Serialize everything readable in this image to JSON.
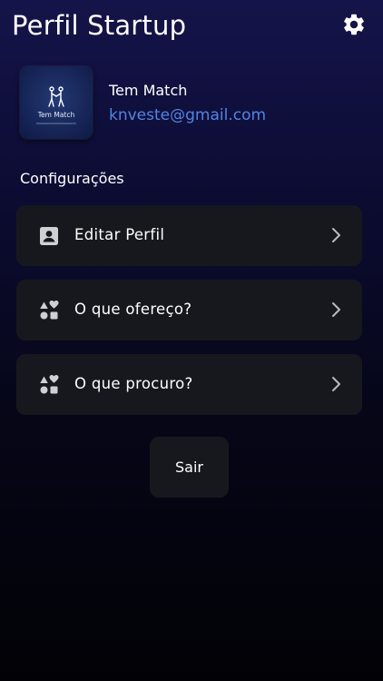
{
  "header": {
    "title": "Perfil Startup",
    "settings_icon": "gear-icon"
  },
  "profile": {
    "logo_text": "Tem Match",
    "name": "Tem Match",
    "email": "knveste@gmail.com",
    "email_color": "#4e86e6"
  },
  "settings": {
    "section_title": "Configurações",
    "items": [
      {
        "label": "Editar Perfil",
        "icon": "contact-card-icon"
      },
      {
        "label": "O que ofereço?",
        "icon": "category-shapes-icon"
      },
      {
        "label": "O que procuro?",
        "icon": "category-shapes-icon"
      }
    ]
  },
  "logout": {
    "label": "Sair"
  },
  "colors": {
    "background_top": "#15144a",
    "background_bottom": "#020206",
    "card": "#17181e",
    "accent": "#4e86e6"
  }
}
